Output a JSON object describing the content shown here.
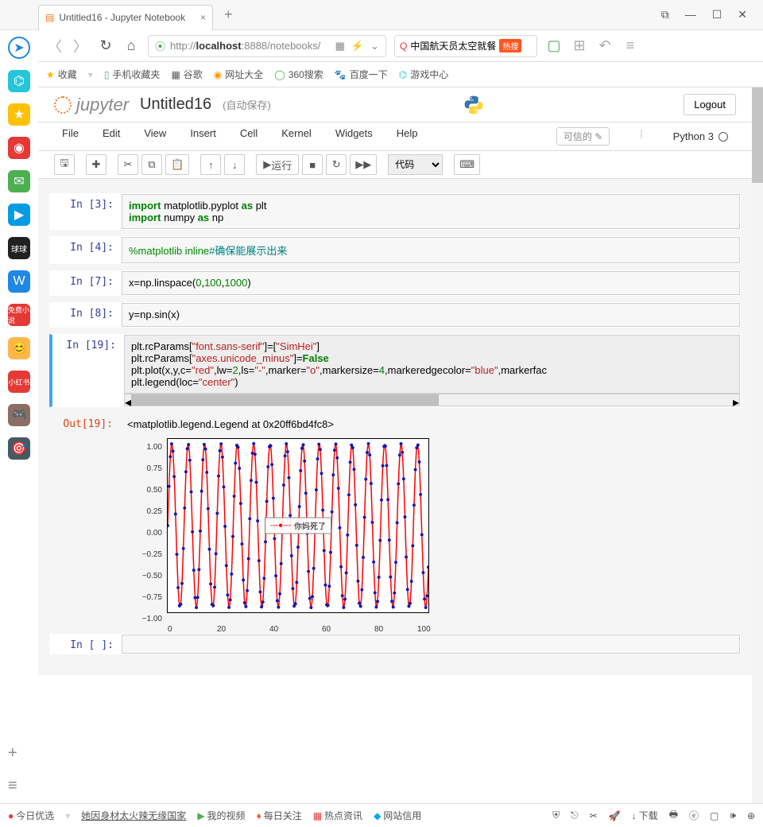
{
  "browser": {
    "tab_title": "Untitled16 - Jupyter Notebook",
    "url_display": "http://localhost:8888/notebooks/",
    "url_bold_part": "localhost",
    "search_text": "中国航天员太空就餐",
    "hot_badge": "热搜"
  },
  "bookmarks": {
    "fav": "收藏",
    "mobile": "手机收藏夹",
    "google": "谷歌",
    "netall": "网址大全",
    "sousuo": "360搜索",
    "baidu": "百度一下",
    "game": "游戏中心"
  },
  "jupyter": {
    "logo_text": "jupyter",
    "title": "Untitled16",
    "autosave": "(自动保存)",
    "logout": "Logout",
    "trusted": "可信的",
    "kernel": "Python 3"
  },
  "menus": {
    "file": "File",
    "edit": "Edit",
    "view": "View",
    "insert": "Insert",
    "cell": "Cell",
    "kernel": "Kernel",
    "widgets": "Widgets",
    "help": "Help"
  },
  "toolbar": {
    "run_label": "运行",
    "cell_type": "代码"
  },
  "cells": {
    "c3_prompt": "In  [3]:",
    "c3_l1a": "import",
    "c3_l1b": " matplotlib.pyplot ",
    "c3_l1c": "as",
    "c3_l1d": " plt",
    "c3_l2a": "import",
    "c3_l2b": " numpy ",
    "c3_l2c": "as",
    "c3_l2d": " np",
    "c4_prompt": "In  [4]:",
    "c4_a": "%matplotlib inline",
    "c4_b": "#确保能展示出来",
    "c7_prompt": "In  [7]:",
    "c7_a": "x",
    "c7_b": "=np.linspace(",
    "c7_c": "0",
    "c7_d": ",",
    "c7_e": "100",
    "c7_f": ",",
    "c7_g": "1000",
    "c7_h": ")",
    "c8_prompt": "In  [8]:",
    "c8_a": "y",
    "c8_b": "=np.sin(x)",
    "c19_prompt": "In [19]:",
    "c19_l1": "plt.rcParams[\"font.sans-serif\"]=[\"SimHei\"]",
    "c19_l2a": "plt.rcParams[",
    "c19_l2b": "\"axes.unicode_minus\"",
    "c19_l2c": "]=",
    "c19_l2d": "False",
    "c19_l3": "plt.plot(x,y,c=\"red\",lw=2,ls=\"-\",marker=\"o\",markersize=4,markeredgecolor=\"blue\",markerface",
    "c19_l4": "plt.legend(loc=\"center\")",
    "out19_prompt": "Out[19]:",
    "out19_text": "<matplotlib.legend.Legend at 0x20ff6bd4fc8>",
    "empty_prompt": "In  [ ]:"
  },
  "chart_data": {
    "type": "line",
    "x_range": [
      0,
      100
    ],
    "y_range": [
      -1,
      1
    ],
    "xticks": [
      0,
      20,
      40,
      60,
      80,
      100
    ],
    "yticks": [
      -1.0,
      -0.75,
      -0.5,
      -0.25,
      0.0,
      0.25,
      0.5,
      0.75,
      1.0
    ],
    "series": [
      {
        "name": "你妈死了",
        "function": "sin(x)",
        "n_points": 1000,
        "line_color": "red",
        "marker": "o",
        "markersize": 4,
        "marker_edge": "blue"
      }
    ],
    "legend_loc": "center",
    "legend_text": "你妈死了"
  },
  "bottombar": {
    "today": "今日优选",
    "hot_news": "她因身材太火辣无缘国家",
    "video": "我的视频",
    "dayfocus": "每日关注",
    "hotinfo": "热点资讯",
    "sitecredit": "网站信用",
    "download": "下载"
  }
}
